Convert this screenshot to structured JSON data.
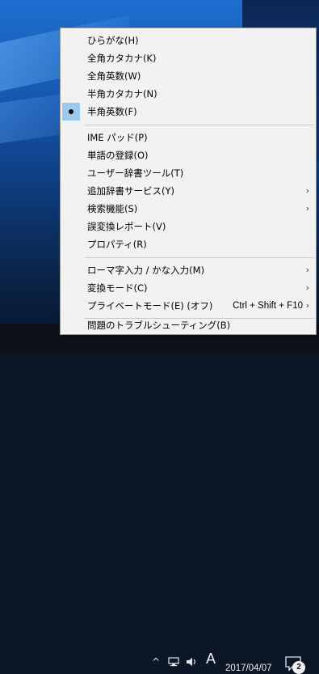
{
  "menu": {
    "items": [
      {
        "label": "ひらがな(H)"
      },
      {
        "label": "全角カタカナ(K)"
      },
      {
        "label": "全角英数(W)"
      },
      {
        "label": "半角カタカナ(N)"
      },
      {
        "label": "半角英数(F)",
        "checked": true
      },
      {
        "label": "IME パッド(P)"
      },
      {
        "label": "単語の登録(O)"
      },
      {
        "label": "ユーザー辞書ツール(T)"
      },
      {
        "label": "追加辞書サービス(Y)",
        "submenu": true
      },
      {
        "label": "検索機能(S)",
        "submenu": true
      },
      {
        "label": "誤変換レポート(V)"
      },
      {
        "label": "プロパティ(R)"
      },
      {
        "label": "ローマ字入力 / かな入力(M)",
        "submenu": true
      },
      {
        "label": "変換モード(C)",
        "submenu": true
      },
      {
        "label": "プライベートモード(E) (オフ)",
        "shortcut": "Ctrl + Shift + F10",
        "submenu": true
      },
      {
        "label": "問題のトラブルシューティング(B)"
      }
    ],
    "arrow_glyph": "›",
    "check_color": "#9cc8ee"
  },
  "taskbar": {
    "chevron": "^",
    "ime_indicator": "A",
    "date": "2017/04/07",
    "notification_count": "2"
  }
}
